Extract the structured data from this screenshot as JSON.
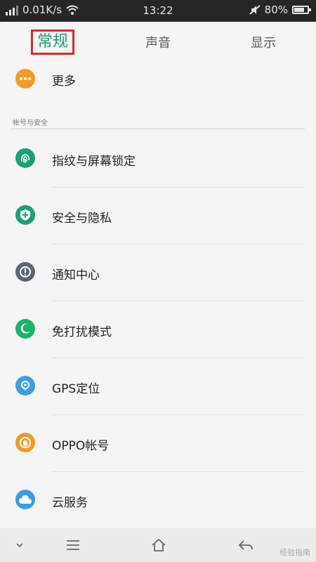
{
  "status_bar": {
    "speed": "0.01K/s",
    "time": "13:22",
    "battery": "80%",
    "battery_level": 0.8,
    "icons": [
      "signal-icon",
      "wifi-icon",
      "mute-icon",
      "battery-icon"
    ]
  },
  "tabs": [
    {
      "label": "常规",
      "active": true
    },
    {
      "label": "声音",
      "active": false
    },
    {
      "label": "显示",
      "active": false
    }
  ],
  "more_item": {
    "label": "更多",
    "icon": "more-icon",
    "color": "#f39a2a"
  },
  "section": {
    "title": "帐号与安全"
  },
  "items": [
    {
      "label": "指纹与屏幕锁定",
      "icon": "fingerprint-icon",
      "color": "#1aa076"
    },
    {
      "label": "安全与隐私",
      "icon": "shield-icon",
      "color": "#1aa076"
    },
    {
      "label": "通知中心",
      "icon": "notification-icon",
      "color": "#5b6677"
    },
    {
      "label": "免打扰模式",
      "icon": "moon-icon",
      "color": "#19b36b"
    },
    {
      "label": "GPS定位",
      "icon": "location-icon",
      "color": "#3d9be9"
    },
    {
      "label": "OPPO帐号",
      "icon": "account-icon",
      "color": "#f39a2a"
    },
    {
      "label": "云服务",
      "icon": "cloud-icon",
      "color": "#3d9be9"
    }
  ],
  "navbar": {
    "items": [
      "chevron-down-icon",
      "menu-icon",
      "home-icon",
      "back-icon"
    ]
  },
  "watermark": "经验指南"
}
